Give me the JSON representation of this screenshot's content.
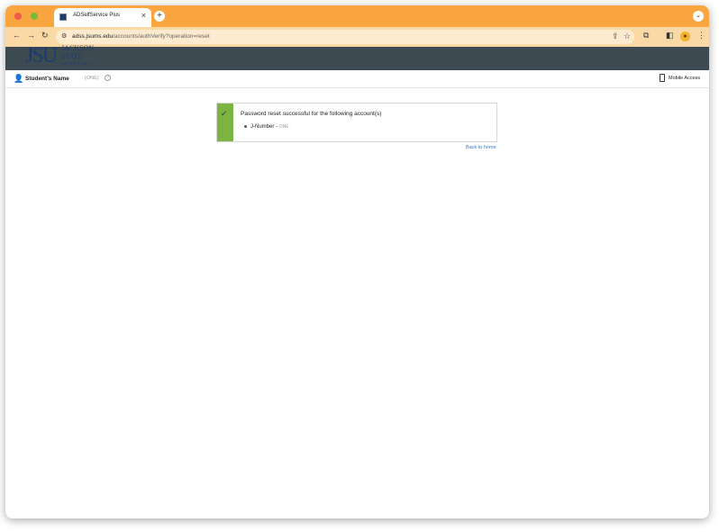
{
  "browser": {
    "tab_title": "ADSelfService Plus",
    "tab_close": "×",
    "new_tab": "+",
    "tab_menu": "⌄",
    "url_host": "adss.jsums.edu",
    "url_path": "/accounts/authVerify?operation=reset",
    "icons": [
      "back-icon",
      "forward-icon",
      "reload-icon",
      "site-info-icon",
      "share-icon",
      "bookmark-star-icon",
      "extensions-icon",
      "sidepanel-icon",
      "profile-avatar",
      "more-menu-icon"
    ]
  },
  "header": {
    "logo_initials": "JSU",
    "logo_line1": "JACKSON",
    "logo_line2": "STATE",
    "logo_line3": "UNIVERSITY",
    "accent": "#3d4a52"
  },
  "userbar": {
    "user_name": "Student's Name",
    "domain": "(ONE)",
    "help": "?",
    "mobile_label": "Mobile Access"
  },
  "result": {
    "message": "Password reset successful for the following account(s)",
    "account_name": "J-Number",
    "account_sep": " - ",
    "account_domain": "ONE",
    "back_link": "Back to home",
    "status_color": "#7cb342"
  }
}
